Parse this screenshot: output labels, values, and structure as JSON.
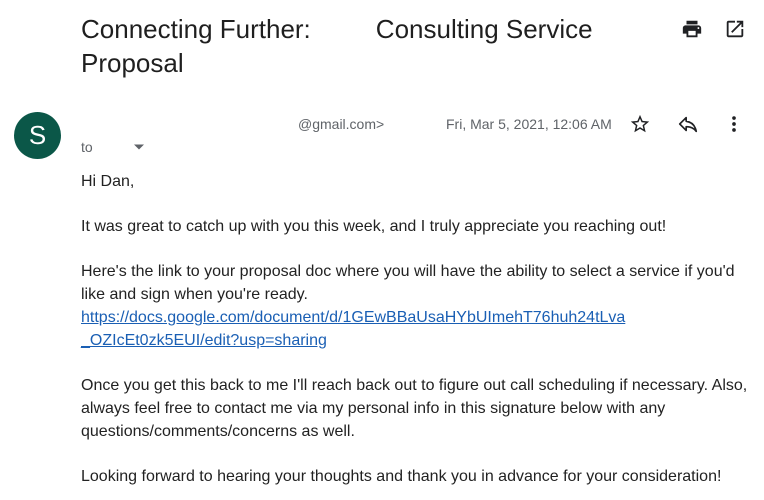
{
  "email": {
    "subject": "Connecting Further:         Consulting Service Proposal",
    "sender_initial": "S",
    "sender_email": "@gmail.com>",
    "timestamp": "Fri, Mar 5, 2021, 12:06 AM",
    "to_label": "to",
    "greeting": "Hi Dan,",
    "paragraph_1": "It was great to catch up with you this week, and I truly appreciate you reaching out!",
    "paragraph_2": "Here's the link to your proposal doc where you will have the ability to select a service if you'd like and sign when you're ready.",
    "link_line_1": "https://docs.google.com/document/d/1GEwBBaUsaHYbUImehT76huh24tLva",
    "link_line_2": "_OZIcEt0zk5EUI/edit?usp=sharing",
    "paragraph_3": "Once you get this back to me I'll reach back out to figure out call scheduling if necessary. Also, always feel free to contact me via my personal info in this signature below with any questions/comments/concerns as well.",
    "paragraph_4": "Looking forward to hearing your thoughts and thank you in advance for your consideration!"
  },
  "icons": {
    "print": "print-icon",
    "open_new_window": "open-in-new-icon",
    "star": "star-icon",
    "reply": "reply-icon",
    "more": "more-vert-icon",
    "caret": "caret-down-icon"
  },
  "colors": {
    "avatar_bg": "#0b5748",
    "link": "#1a5fb4",
    "secondary_text": "#5f6368"
  }
}
